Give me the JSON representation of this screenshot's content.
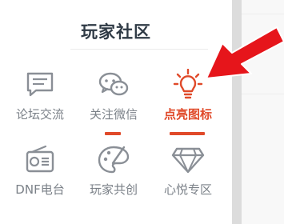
{
  "section": {
    "title": "玩家社区"
  },
  "items": [
    {
      "label": "论坛交流",
      "icon": "forum-chat-icon",
      "active": false
    },
    {
      "label": "关注微信",
      "icon": "wechat-icon",
      "active": false
    },
    {
      "label": "点亮图标",
      "icon": "lightbulb-icon",
      "active": true
    },
    {
      "label": "DNF电台",
      "icon": "radio-icon",
      "active": false
    },
    {
      "label": "玩家共创",
      "icon": "palette-icon",
      "active": false
    },
    {
      "label": "心悦专区",
      "icon": "diamond-icon",
      "active": false
    }
  ],
  "colors": {
    "accent": "#e04a2a",
    "icon_gray": "#8a8f96",
    "label_gray": "#7b8188",
    "title": "#2f3a45",
    "arrow_red": "#e6151b"
  }
}
